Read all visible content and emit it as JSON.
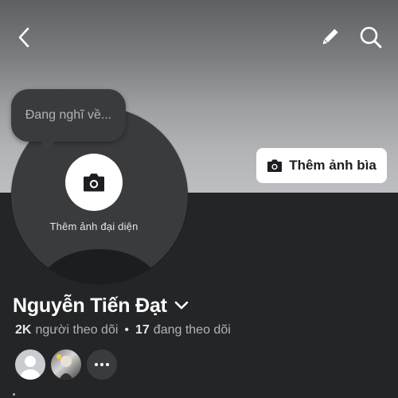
{
  "header": {
    "back_icon": "chevron-left-icon",
    "edit_icon": "pencil-icon",
    "search_icon": "search-icon"
  },
  "cover": {
    "add_cover_label": "Thêm ảnh bìa",
    "camera_icon": "camera-icon"
  },
  "avatar": {
    "add_avatar_label": "Thêm ảnh đại diện",
    "camera_icon": "camera-icon"
  },
  "thought_bubble": {
    "placeholder": "Đang nghĩ về..."
  },
  "profile": {
    "name": "Nguyễn Tiến Đạt",
    "followers_count": "2K",
    "followers_label": "người theo dõi",
    "separator": "•",
    "following_count": "17",
    "following_label": "đang theo dõi"
  },
  "friends": {
    "more_icon": "more-dots-icon"
  },
  "colors": {
    "background": "#242526",
    "text_primary": "#ffffff",
    "text_secondary": "#b0b3b8",
    "button_bg": "#ffffff"
  }
}
